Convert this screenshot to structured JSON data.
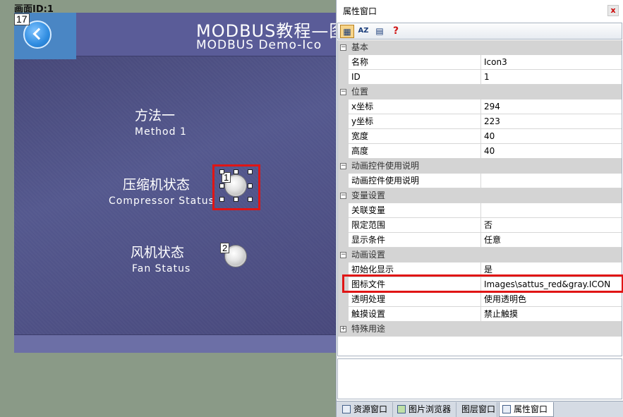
{
  "screen": {
    "label": "画面ID:1",
    "back_tag": "17",
    "title_main": "MODBUS教程—图",
    "title_sub": "MODBUS Demo-Ico"
  },
  "widgets": [
    {
      "cn": "方法一",
      "en": "Method 1"
    },
    {
      "cn": "压缩机状态",
      "en": "Compressor Status",
      "tag": "1"
    },
    {
      "cn": "风机状态",
      "en": "Fan Status",
      "tag": "2"
    }
  ],
  "property_window": {
    "title": "属性窗口",
    "close_label": "x",
    "toolbar": {
      "alpha_label": "AZ",
      "help_label": "?"
    },
    "sections": [
      {
        "name": "基本",
        "rows": [
          {
            "name": "名称",
            "value": "Icon3"
          },
          {
            "name": "ID",
            "value": "1"
          }
        ]
      },
      {
        "name": "位置",
        "rows": [
          {
            "name": "x坐标",
            "value": "294"
          },
          {
            "name": "y坐标",
            "value": "223"
          },
          {
            "name": "宽度",
            "value": "40"
          },
          {
            "name": "高度",
            "value": "40"
          }
        ]
      },
      {
        "name": "动画控件使用说明",
        "rows": [
          {
            "name": "动画控件使用说明",
            "value": ""
          }
        ]
      },
      {
        "name": "变量设置",
        "rows": [
          {
            "name": "关联变量",
            "value": ""
          },
          {
            "name": "限定范围",
            "value": "否"
          },
          {
            "name": "显示条件",
            "value": "任意"
          }
        ]
      },
      {
        "name": "动画设置",
        "rows": [
          {
            "name": "初始化显示",
            "value": "是"
          },
          {
            "name": "图标文件",
            "value": "Images\\sattus_red&gray.ICON"
          },
          {
            "name": "透明处理",
            "value": "使用透明色"
          },
          {
            "name": "触摸设置",
            "value": "禁止触摸"
          }
        ]
      },
      {
        "name": "特殊用途",
        "rows": []
      }
    ],
    "tabs": [
      "资源窗口",
      "图片浏览器",
      "图层窗口",
      "属性窗口"
    ]
  }
}
